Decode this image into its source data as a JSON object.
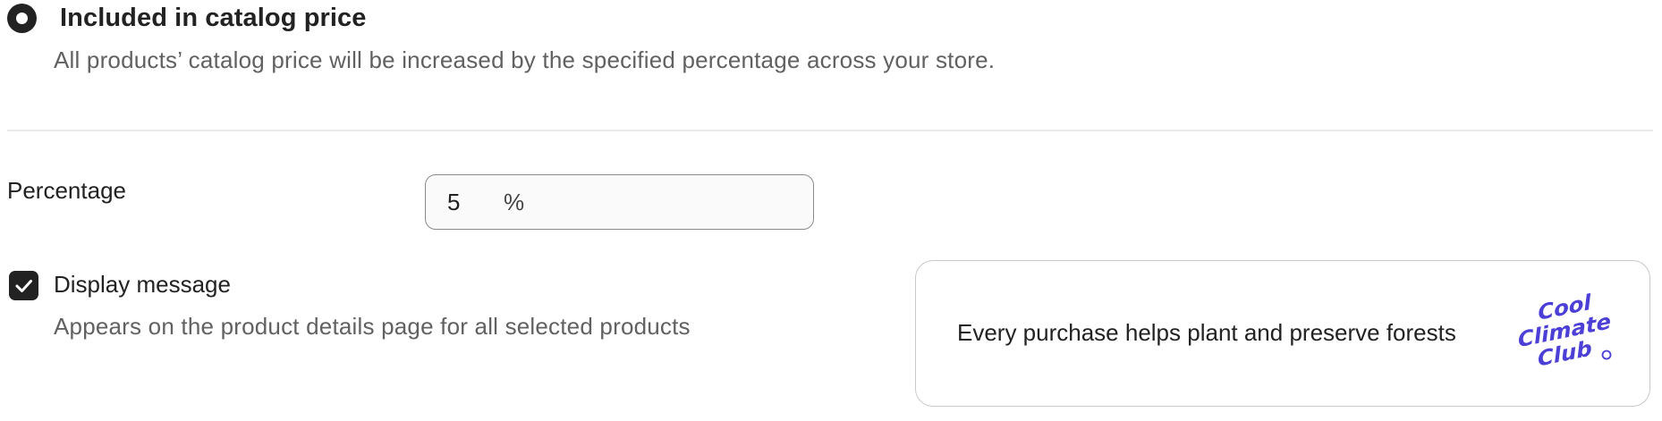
{
  "tax_option": {
    "label": "Included in catalog price",
    "description": "All products’ catalog price will be increased by the specified percentage across your store.",
    "selected": true
  },
  "percentage": {
    "label": "Percentage",
    "value": "5",
    "suffix": "%"
  },
  "display_message": {
    "label": "Display message",
    "description": "Appears on the product details page for all selected products",
    "checked": true,
    "icon": "checkmark-icon"
  },
  "preview": {
    "message": "Every purchase helps plant and preserve forests",
    "logo": {
      "line1": "Cool",
      "line2": "Climate",
      "line3": "Club",
      "color": "#4b3fd6"
    }
  },
  "colors": {
    "primary_text": "#222222",
    "secondary_text": "#616161",
    "divider": "#ebebeb",
    "logo_purple": "#4b3fd6"
  }
}
